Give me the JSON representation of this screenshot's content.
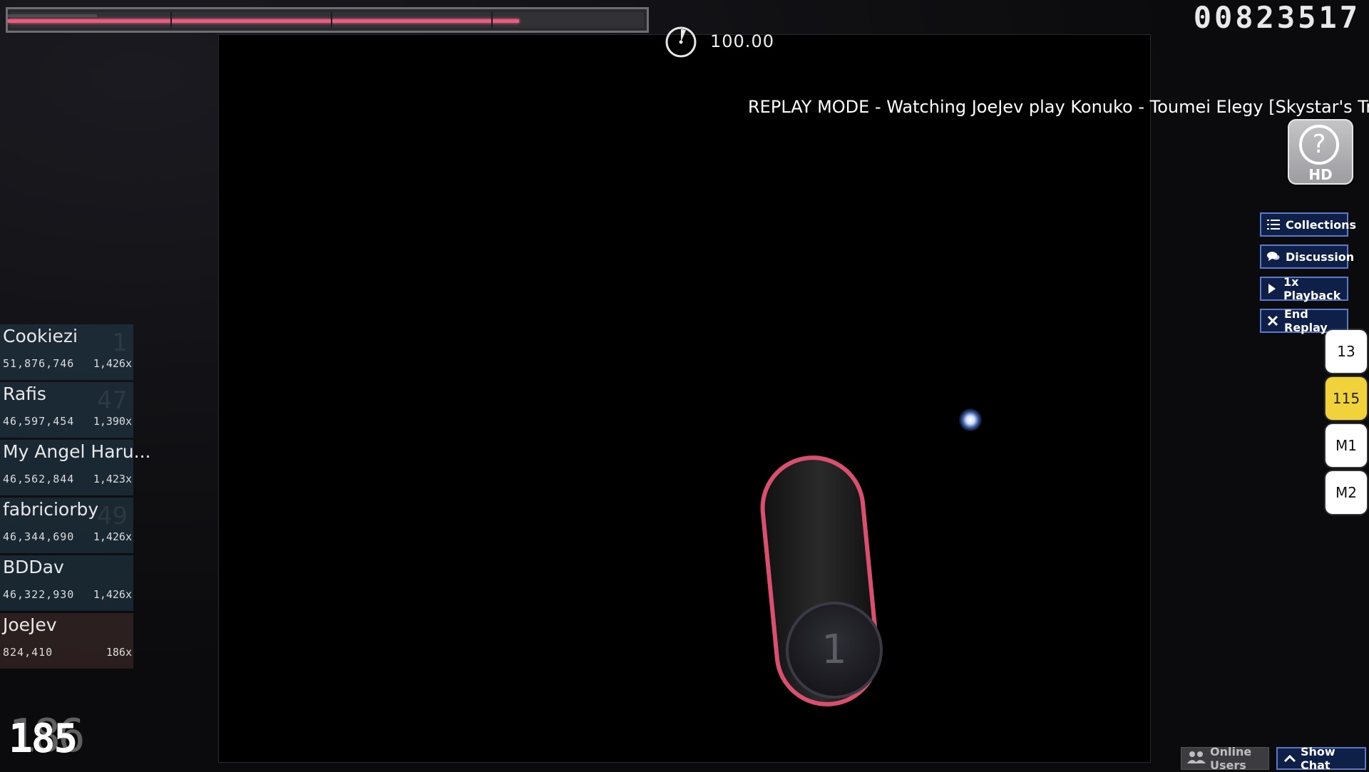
{
  "hud": {
    "accuracy": "100.00",
    "score": "00823517",
    "health_fraction": 0.8,
    "replay_text": "REPLAY MODE - Watching JoeJev play Konuko - Toumei Elegy [Skystar's Tragic"
  },
  "mod": {
    "label": "HD",
    "glyph": "?"
  },
  "side_buttons": [
    {
      "label": "Collections",
      "icon": "list-icon"
    },
    {
      "label": "Discussion",
      "icon": "chat-bubble-icon"
    },
    {
      "label": "1x Playback",
      "icon": "play-icon"
    },
    {
      "label": "End Replay",
      "icon": "close-icon"
    }
  ],
  "keys": [
    {
      "label": "13",
      "active": false
    },
    {
      "label": "115",
      "active": true
    },
    {
      "label": "M1",
      "active": false
    },
    {
      "label": "M2",
      "active": false
    }
  ],
  "leaderboard": [
    {
      "name": "Cookiezi",
      "score": "51,876,746",
      "combo": "1,426x",
      "ghost": "1"
    },
    {
      "name": "Rafis",
      "score": "46,597,454",
      "combo": "1,390x",
      "ghost": "47"
    },
    {
      "name": "My Angel Haru...",
      "score": "46,562,844",
      "combo": "1,423x",
      "ghost": ""
    },
    {
      "name": "fabriciorby",
      "score": "46,344,690",
      "combo": "1,426x",
      "ghost": "49"
    },
    {
      "name": "BDDav",
      "score": "46,322,930",
      "combo": "1,426x",
      "ghost": ""
    },
    {
      "name": "JoeJev",
      "score": "824,410",
      "combo": "186x",
      "ghost": ""
    }
  ],
  "combo": {
    "back": "186",
    "front": "185"
  },
  "hit_object": {
    "number": "1"
  },
  "bottom": {
    "online_users": "Online Users",
    "show_chat": "Show Chat"
  },
  "colors": {
    "hp": "#e85c7e",
    "slider_border": "#d9506f",
    "button_bg": "#0e1f48",
    "button_border": "#5b7ac8",
    "key_active": "#f2d23a"
  }
}
